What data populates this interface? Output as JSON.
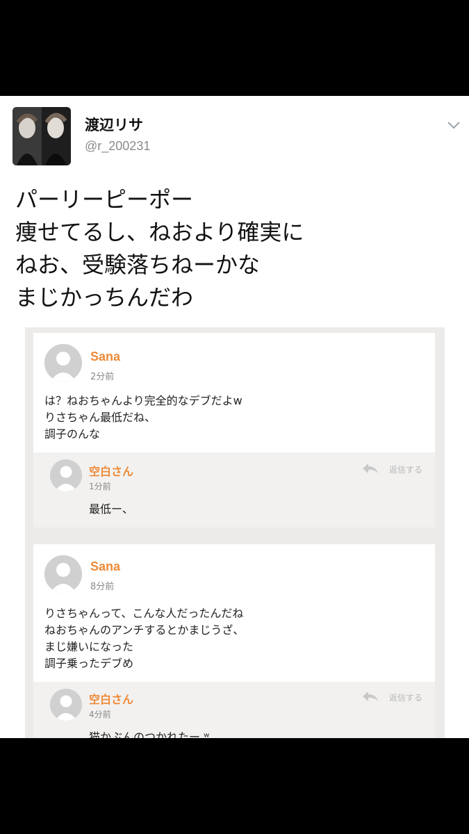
{
  "tweet": {
    "display_name": "渡辺リサ",
    "handle": "@r_200231",
    "lines": [
      "パーリーピーポー",
      "痩せてるし、ねおより確実に",
      "ねお、受験落ちねーかな",
      "まじかっちんだわ"
    ]
  },
  "comments": [
    {
      "author": "Sana",
      "time": "2分前",
      "lines": [
        "は？ねおちゃんより完全的なデブだよw",
        "りさちゃん最低だね、",
        "調子のんな"
      ],
      "reply": {
        "author": "空白さん",
        "time": "1分前",
        "text": "最低ー、",
        "action": "返信する"
      }
    },
    {
      "author": "Sana",
      "time": "8分前",
      "lines": [
        "りさちゃんって、こんな人だったんだね",
        "ねおちゃんのアンチするとかまじうざ、",
        "まじ嫌いになった",
        "調子乗ったデブめ"
      ],
      "reply": {
        "author": "空白さん",
        "time": "4分前",
        "text": "猫かぶんのつかれたー ʷ",
        "action": "返信する"
      }
    }
  ],
  "icons": [
    "chevron-down-icon",
    "default-avatar-icon",
    "reply-arrow-icon"
  ]
}
